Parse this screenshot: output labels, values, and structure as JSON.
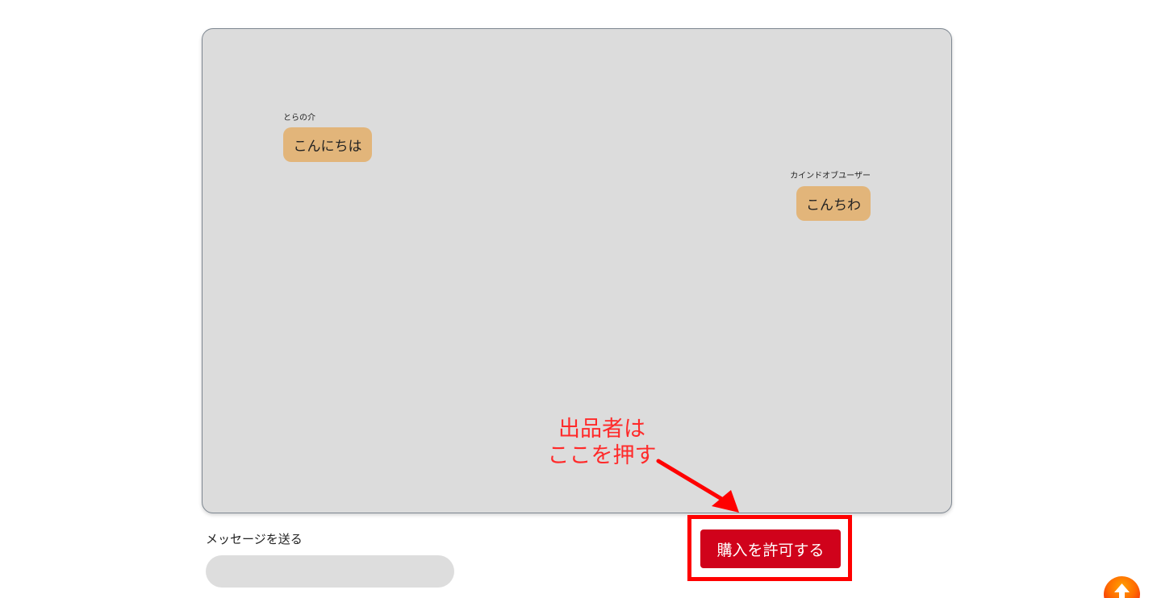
{
  "chat": {
    "messages": [
      {
        "sender": "とらの介",
        "text": "こんにちは",
        "side": "left"
      },
      {
        "sender": "カインドオブユーザー",
        "text": "こんちわ",
        "side": "right"
      }
    ]
  },
  "send_message": {
    "label": "メッセージを送る",
    "value": "",
    "placeholder": ""
  },
  "actions": {
    "allow_purchase_label": "購入を許可する"
  },
  "annotation": {
    "line1": "出品者は",
    "line2": "ここを押す",
    "color": "#ff0000"
  },
  "colors": {
    "panel_bg": "#dcdcdc",
    "bubble_bg": "#e2b57a",
    "button_bg": "#d0021b"
  },
  "icons": {
    "scroll_top": "arrow-up-icon"
  }
}
